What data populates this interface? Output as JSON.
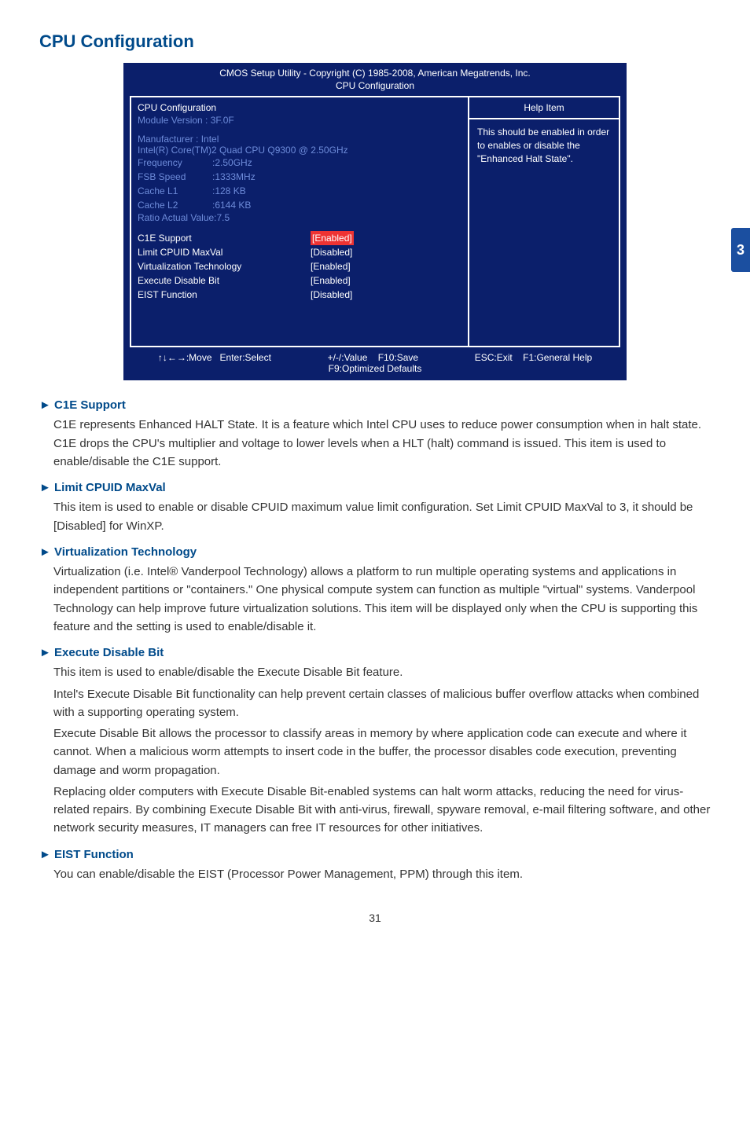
{
  "section_title": "CPU Configuration",
  "bios": {
    "title_line1": "CMOS Setup Utility - Copyright (C) 1985-2008, American Megatrends, Inc.",
    "title_line2": "CPU Configuration",
    "left_header": "CPU Configuration",
    "module_version": "Module Version :  3F.0F",
    "manufacturer": "Manufacturer :  Intel",
    "cpu_line": "Intel(R) Core(TM)2 Quad  CPU    Q9300    @  2.50GHz",
    "rows": [
      {
        "k": "Frequency",
        "v": ":2.50GHz"
      },
      {
        "k": "FSB Speed",
        "v": ":1333MHz"
      },
      {
        "k": "Cache L1",
        "v": ":128  KB"
      },
      {
        "k": "Cache L2",
        "v": ":6144 KB"
      }
    ],
    "ratio": " Ratio Actual Value:7.5",
    "options": [
      {
        "name": "C1E Support",
        "val": "[Enabled]",
        "hl": true
      },
      {
        "name": "Limit CPUID MaxVal",
        "val": "[Disabled]",
        "hl": false
      },
      {
        "name": "Virtualization Technology",
        "val": "[Enabled]",
        "hl": false
      },
      {
        "name": "Execute Disable Bit",
        "val": "[Enabled]",
        "hl": false
      },
      {
        "name": "EIST Function",
        "val": "[Disabled]",
        "hl": false
      }
    ],
    "help_header": "Help Item",
    "help_body": "This should be enabled in order to enables or disable the \"Enhanced Halt State\".",
    "footer": {
      "move": "↑↓←→:Move",
      "select": "Enter:Select",
      "value": "+/-/:Value",
      "save": "F10:Save",
      "exit": "ESC:Exit",
      "help": "F1:General Help",
      "defaults": "F9:Optimized Defaults"
    }
  },
  "items": [
    {
      "head": "► C1E Support",
      "paras": [
        "C1E represents Enhanced HALT State. It is a feature which Intel CPU uses to reduce power consumption when in halt state. C1E drops the CPU's multiplier and voltage to lower levels when a HLT (halt) command is issued. This item is used to enable/disable the C1E support."
      ]
    },
    {
      "head": "► Limit CPUID MaxVal",
      "paras": [
        "This item is used to enable or disable CPUID maximum value limit configuration. Set Limit CPUID MaxVal to 3, it should be [Disabled] for WinXP."
      ]
    },
    {
      "head": "► Virtualization Technology",
      "paras": [
        "Virtualization (i.e. Intel® Vanderpool Technology) allows a platform to run multiple operating systems and applications in independent partitions or \"containers.\" One physical compute system can function as multiple \"virtual\" systems. Vanderpool Technology can help improve future virtualization solutions. This item will be displayed only when the CPU is supporting this feature and the setting is used to enable/disable it."
      ]
    },
    {
      "head": "► Execute Disable Bit",
      "paras": [
        "This item is used to enable/disable the Execute Disable Bit feature.",
        "Intel's Execute Disable Bit functionality can help prevent certain classes of malicious buffer overflow attacks when combined with a supporting operating system.",
        "Execute Disable Bit allows the processor to classify areas in memory by where application code can execute and where it cannot. When a malicious worm attempts to insert code in the buffer, the processor disables code execution, preventing damage and worm propagation.",
        "Replacing older computers with Execute Disable Bit-enabled systems can halt worm attacks, reducing the need for virus-related repairs. By combining Execute Disable Bit with anti-virus, firewall, spyware removal, e-mail filtering software, and other network security measures, IT managers can free IT resources for other initiatives."
      ]
    },
    {
      "head": "► EIST Function",
      "paras": [
        "You can enable/disable the EIST (Processor Power Management, PPM) through this item."
      ]
    }
  ],
  "page_number": "31",
  "side_tab": "3"
}
